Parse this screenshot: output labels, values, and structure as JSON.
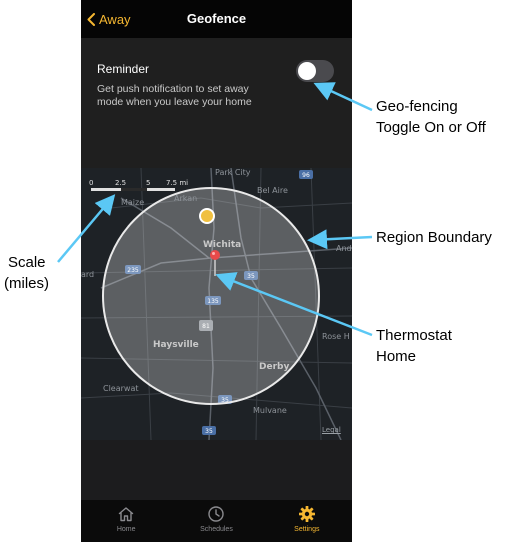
{
  "navbar": {
    "back_label": "Away",
    "title": "Geofence"
  },
  "reminder": {
    "title": "Reminder",
    "description": "Get push notification to set away mode when you leave your home",
    "toggle_on": false
  },
  "map": {
    "scale_ticks": [
      "0",
      "2.5",
      "5",
      "7.5 mi"
    ],
    "labels": {
      "park_city": "Park City",
      "bel_aire": "Bel Aire",
      "maize": "Maize",
      "arkansas": "Arkan",
      "wichita": "Wichita",
      "andover": "And",
      "ward": "ard",
      "haysville": "Haysville",
      "rose_hill": "Rose H",
      "derby": "Derby",
      "clearwater": "Clearwat",
      "mulvane": "Mulvane"
    },
    "highway_shields": [
      "96",
      "235",
      "35",
      "135",
      "81",
      "35",
      "35"
    ],
    "legal_label": "Legal"
  },
  "tabs": [
    {
      "label": "Home",
      "icon": "home-icon",
      "active": false
    },
    {
      "label": "Schedules",
      "icon": "clock-icon",
      "active": false
    },
    {
      "label": "Settings",
      "icon": "gear-icon",
      "active": true
    }
  ],
  "annotations": {
    "toggle_line1": "Geo-fencing",
    "toggle_line2": "Toggle On or Off",
    "region_boundary": "Region Boundary",
    "scale_line1": "Scale",
    "scale_line2": "(miles)",
    "thermostat_line1": "Thermostat",
    "thermostat_line2": "Home"
  },
  "colors": {
    "accent": "#f5b731",
    "annotation_arrow": "#5bc8f5"
  }
}
